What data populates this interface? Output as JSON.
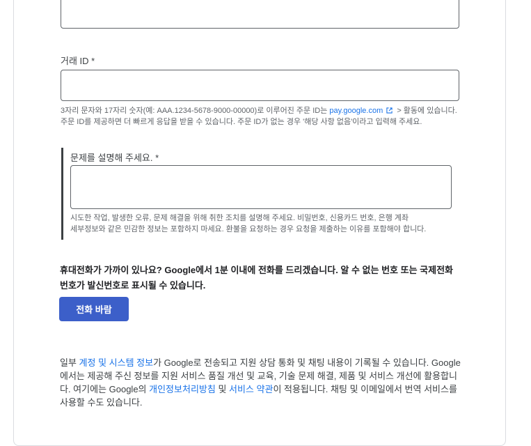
{
  "transaction_id": {
    "label": "거래 ID *",
    "value": "",
    "help_before": "3자리 문자와 17자리 숫자(예: AAA.1234-5678-9000-00000)로 이루어진 주문 ID는 ",
    "help_link": "pay.google.com",
    "help_after": " > 활동에 있습니다. 주문 ID를 제공하면 더 빠르게 응답을 받을 수 있습니다. 주문 ID가 없는 경우 '해당 사항 없음'이라고 입력해 주세요."
  },
  "description": {
    "label": "문제를 설명해 주세요. *",
    "value": "",
    "help_line1": "시도한 작업, 발생한 오류, 문제 해결을 위해 취한 조치를 설명해 주세요. 비밀번호, 신용카드 번호, 은행 계좌",
    "help_line2": "세부정보와 같은 민감한 정보는 포함하지 마세요. 환불을 요청하는 경우 요청을 제출하는 이유를 포함해야 합니다."
  },
  "callback": {
    "text": "휴대전화가 가까이 있나요? Google에서 1분 이내에 전화를 드리겠습니다. 알 수 없는 번호 또는 국제전화 번호가 발신번호로 표시될 수 있습니다.",
    "button_label": "전화 바람"
  },
  "notice": {
    "part1": "일부 ",
    "link_account": "계정 및 시스템 정보",
    "part2": "가 Google로 전송되고 지원 상담 통화 및 채팅 내용이 기록될 수 있습니다. Google에서는 제공해 주신 정보를 지원 서비스 품질 개선 및 교육, 기술 문제 해결, 제품 및 서비스 개선에 활용합니다. 여기에는 Google의 ",
    "link_privacy": "개인정보처리방침",
    "part3": " 및 ",
    "link_terms": "서비스 약관",
    "part4": "이 적용됩니다. 채팅 및 이메일에서 번역 서비스를 사용할 수도 있습니다."
  },
  "colors": {
    "primary_button": "#3c5fc9",
    "link": "#1a73e8",
    "border": "#5f6368"
  }
}
